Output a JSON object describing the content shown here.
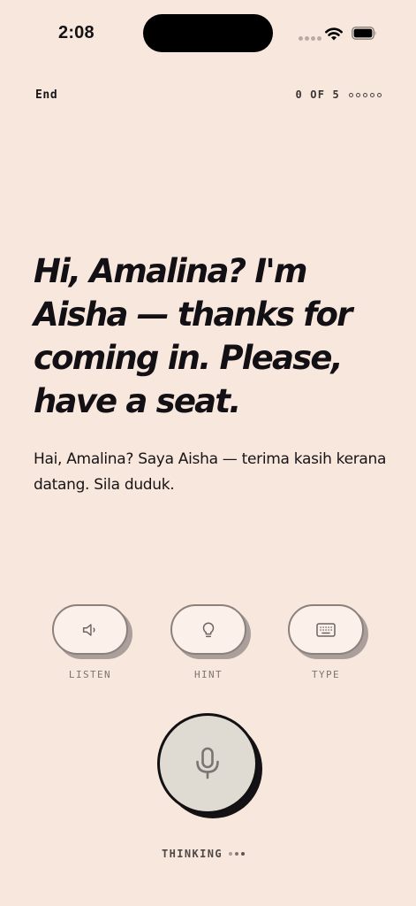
{
  "status_bar": {
    "time": "2:08"
  },
  "header": {
    "end_label": "End",
    "progress_text": "0 OF 5",
    "progress_total": 5,
    "progress_done": 0
  },
  "prompt": {
    "english": "Hi, Amalina? I'm Aisha — thanks for coming in. Please, have a seat.",
    "malay": "Hai, Amalina? Saya Aisha — terima kasih kerana datang. Sila duduk."
  },
  "actions": {
    "listen": {
      "label": "LISTEN",
      "icon": "speaker-icon"
    },
    "hint": {
      "label": "HINT",
      "icon": "lightbulb-icon"
    },
    "type": {
      "label": "TYPE",
      "icon": "keyboard-icon"
    }
  },
  "mic": {
    "icon": "microphone-icon"
  },
  "state": {
    "label": "THINKING"
  },
  "colors": {
    "background": "#f8e7dc",
    "text": "#141214",
    "button_fill": "#fbf1ea",
    "mic_fill": "#dfdad2",
    "shadow": "#aa9f9a"
  }
}
